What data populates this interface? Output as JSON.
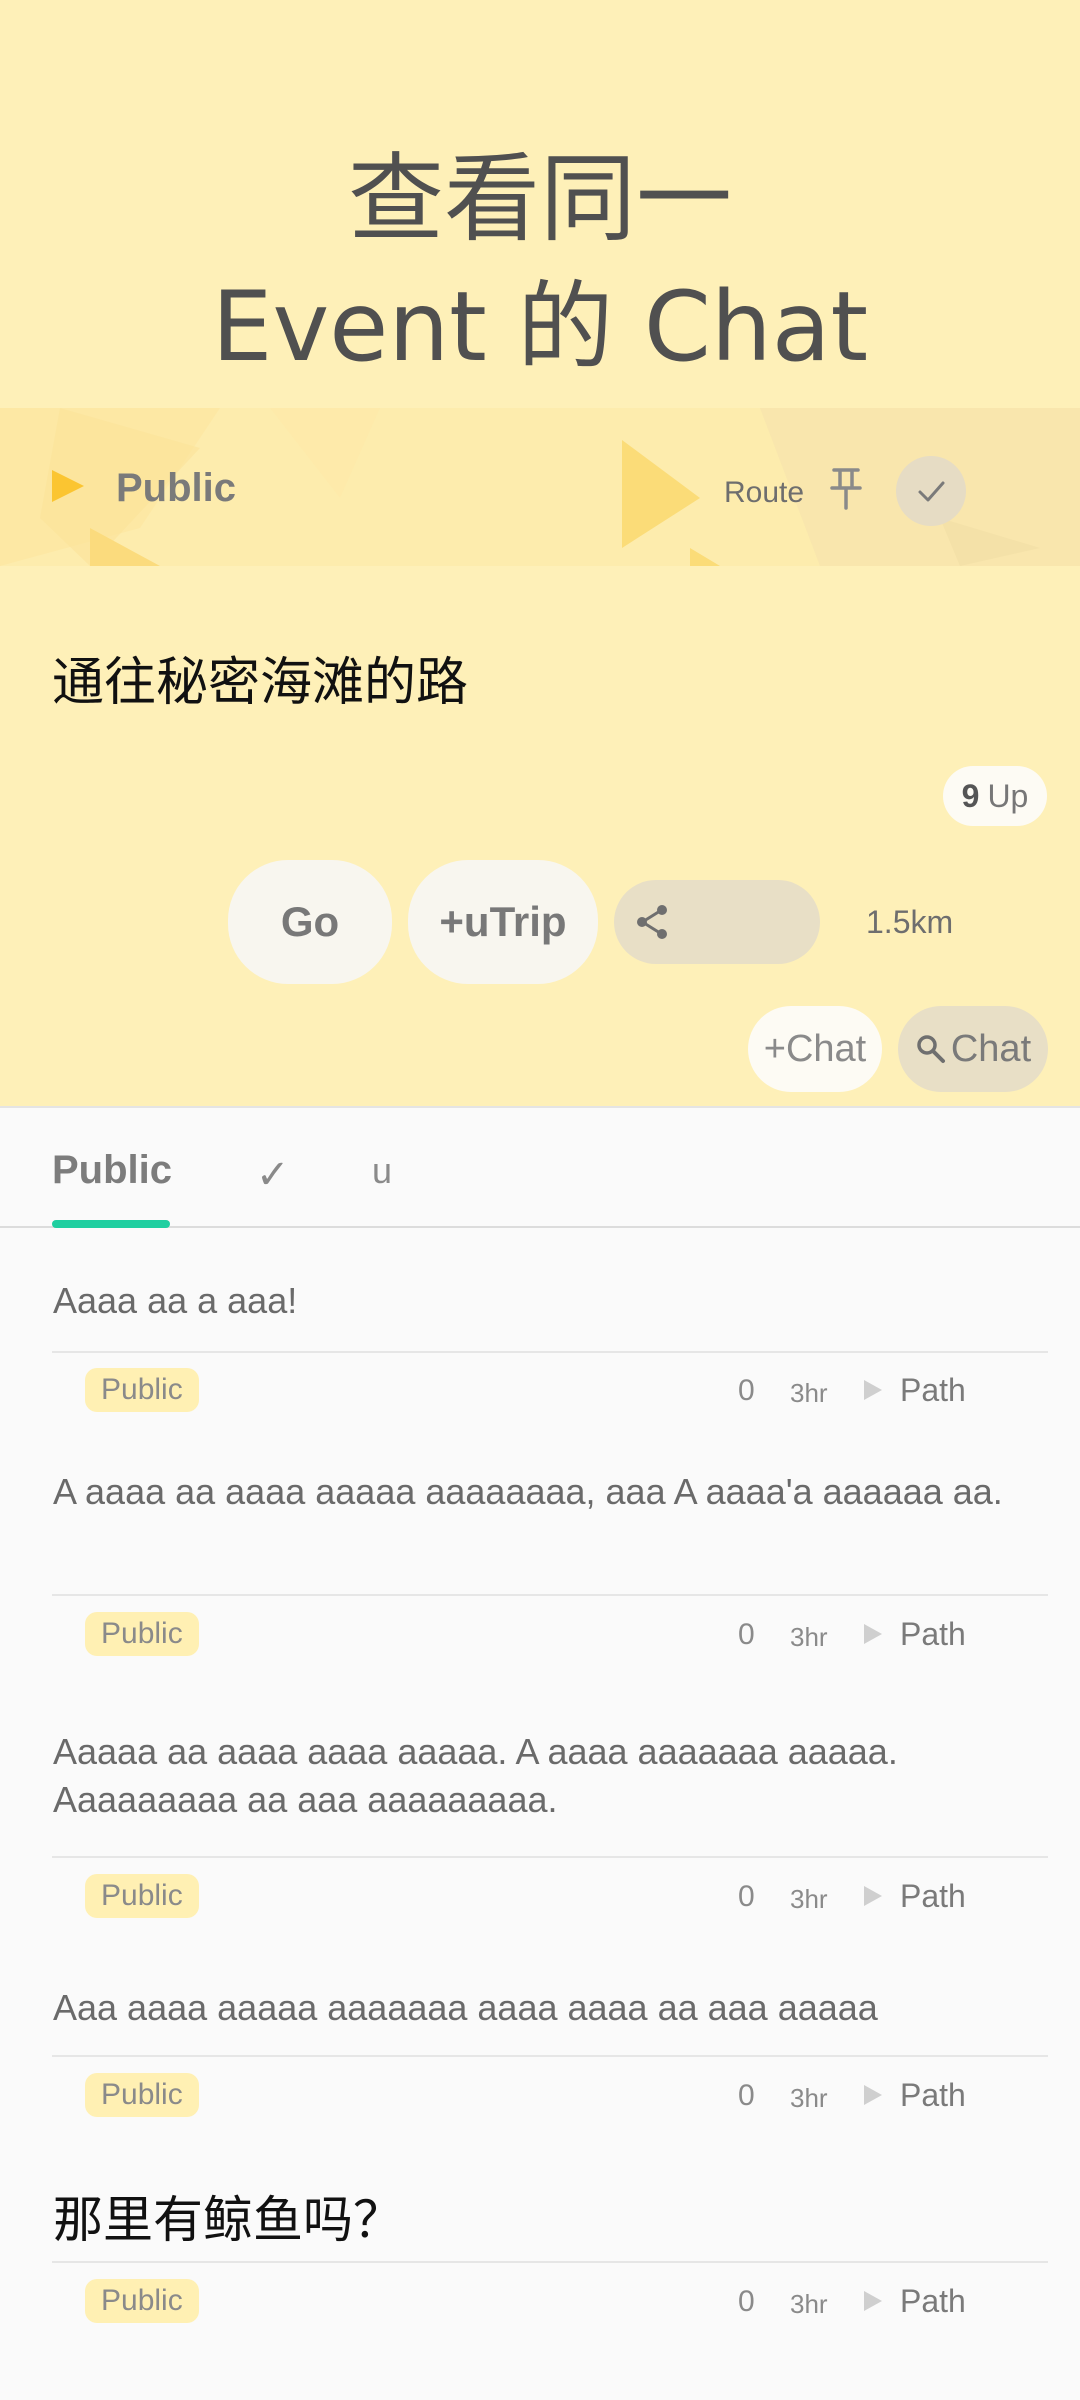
{
  "promo": {
    "title_line1": "查看同一",
    "title_line2": "Event 的  Chat"
  },
  "banner": {
    "visibility_label": "Public",
    "route_label": "Route",
    "icons": [
      "play-triangle-icon",
      "pin-icon",
      "check-icon"
    ]
  },
  "event": {
    "title": "通往秘密海滩的路",
    "up_count": "9",
    "up_label": "Up",
    "go_label": "Go",
    "trip_label": "+uTrip",
    "distance": "1.5km",
    "add_chat_label": "+Chat",
    "search_chat_label": "Chat"
  },
  "tabs": [
    {
      "label": "Public",
      "active": true
    },
    {
      "label": "✓",
      "active": false
    },
    {
      "label": "u",
      "active": false
    }
  ],
  "colors": {
    "header_bg": "#fef0b8",
    "accent_yellow": "#fbd96a",
    "tab_indicator": "#1fcfa0",
    "tag_bg": "#fff0b3"
  },
  "posts": [
    {
      "text": "Aaaa aa a aaa!",
      "tag": "Public",
      "count": "0",
      "time": "3hr",
      "path": "Path"
    },
    {
      "text": "A aaaa aa aaaa aaaaa aaaaaaaa, aaa A aaaa'a aaaaaa aa.",
      "tag": "Public",
      "count": "0",
      "time": "3hr",
      "path": "Path"
    },
    {
      "text": "Aaaaa aa aaaa aaaa aaaaa. A aaaa aaaaaaa aaaaa. Aaaaaaaaa aa aaa aaaaaaaaa.",
      "tag": "Public",
      "count": "0",
      "time": "3hr",
      "path": "Path"
    },
    {
      "text": "Aaa aaaa aaaaa aaaaaaa aaaa aaaa aa aaa aaaaa",
      "tag": "Public",
      "count": "0",
      "time": "3hr",
      "path": "Path"
    },
    {
      "text": "那里有鲸鱼吗？",
      "tag": "Public",
      "count": "0",
      "time": "3hr",
      "path": "Path"
    }
  ]
}
